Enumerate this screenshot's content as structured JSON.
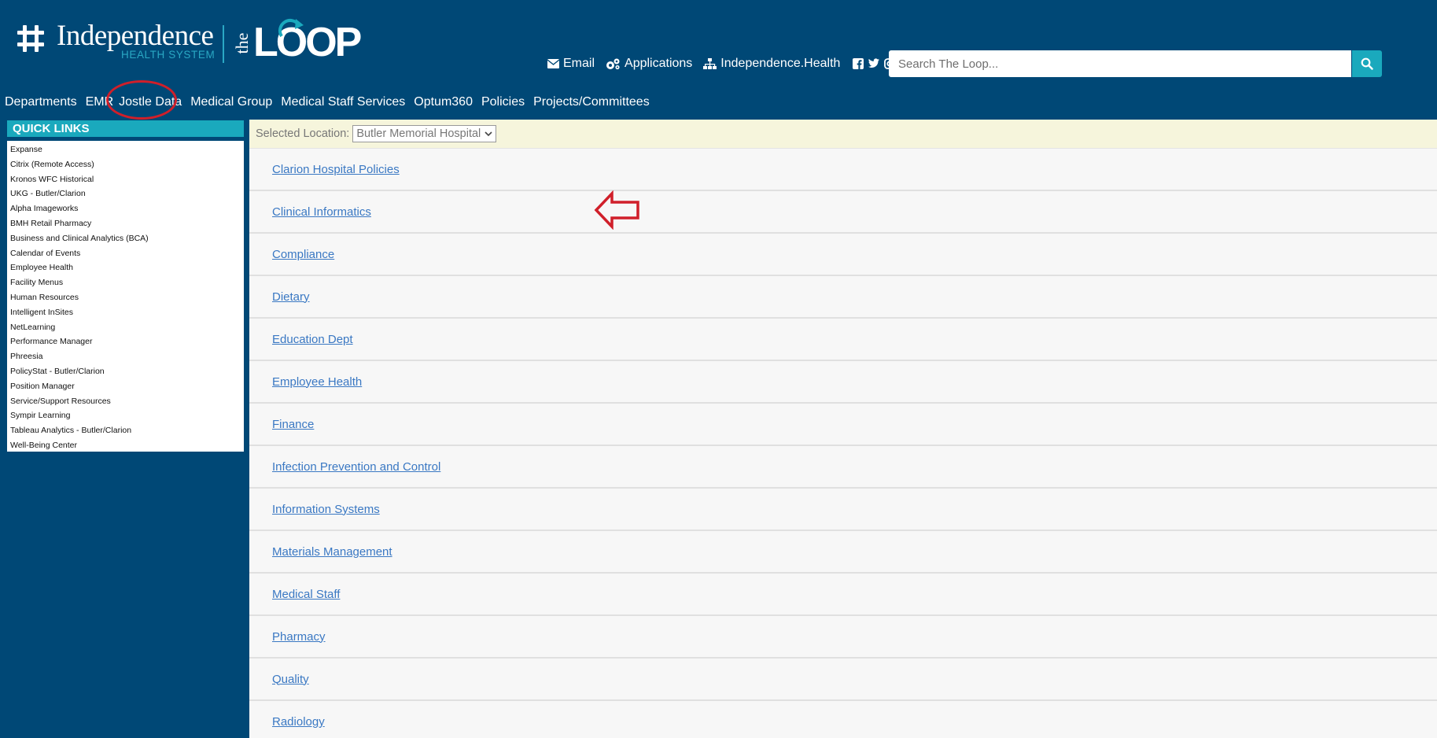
{
  "brand": {
    "name": "Independence",
    "sub": "HEALTH SYSTEM",
    "loop_prefix": "the",
    "loop_word": "LOOP"
  },
  "top_links": [
    {
      "label": "Email",
      "icon": "envelope-icon"
    },
    {
      "label": "Applications",
      "icon": "gears-icon"
    },
    {
      "label": "Independence.Health",
      "icon": "sitemap-icon"
    }
  ],
  "social": [
    "facebook-icon",
    "twitter-icon",
    "instagram-icon"
  ],
  "search": {
    "placeholder": "Search The Loop...",
    "value": ""
  },
  "nav": [
    "Departments",
    "EMR",
    "Jostle Data",
    "Medical Group",
    "Medical Staff Services",
    "Optum360",
    "Policies",
    "Projects/Committees"
  ],
  "quick_links": {
    "title": "QUICK LINKS",
    "items": [
      "Expanse",
      "Citrix (Remote Access)",
      "Kronos WFC Historical",
      "UKG - Butler/Clarion",
      "Alpha Imageworks",
      "BMH Retail Pharmacy",
      "Business and Clinical Analytics (BCA)",
      "Calendar of Events",
      "Employee Health",
      "Facility Menus",
      "Human Resources",
      "Intelligent InSites",
      "NetLearning",
      "Performance Manager",
      "Phreesia",
      "PolicyStat - Butler/Clarion",
      "Position Manager",
      "Service/Support Resources",
      "Sympir Learning",
      "Tableau Analytics - Butler/Clarion",
      "Well-Being Center"
    ]
  },
  "location": {
    "label": "Selected Location:",
    "selected": "Butler Memorial Hospital"
  },
  "departments": [
    "Clarion Hospital Policies",
    "Clinical Informatics",
    "Compliance",
    "Dietary",
    "Education Dept",
    "Employee Health",
    "Finance",
    "Infection Prevention and Control",
    "Information Systems",
    "Materials Management",
    "Medical Staff",
    "Pharmacy",
    "Quality",
    "Radiology"
  ],
  "colors": {
    "header_bg": "#004876",
    "accent": "#1aa9bd",
    "link": "#3a78c3",
    "annotation": "#d01f2a",
    "location_bar": "#f6f5dc"
  }
}
